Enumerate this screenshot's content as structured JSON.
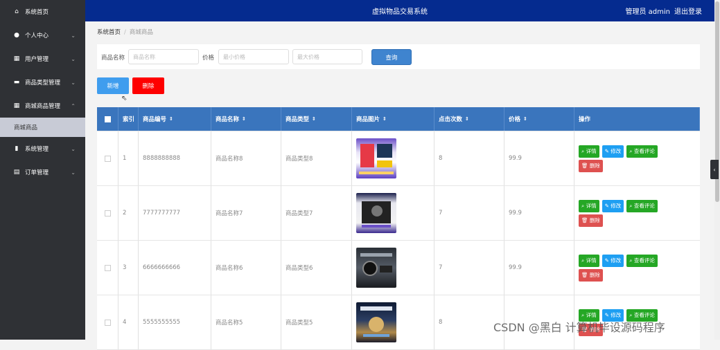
{
  "sidebar": {
    "items": [
      {
        "label": "系统首页",
        "icon": "home-icon",
        "chevron": ""
      },
      {
        "label": "个人中心",
        "icon": "user-icon",
        "chevron": "⌄"
      },
      {
        "label": "用户管理",
        "icon": "grid-icon",
        "chevron": "⌄"
      },
      {
        "label": "商品类型管理",
        "icon": "briefcase-icon",
        "chevron": "⌄"
      },
      {
        "label": "商城商品管理",
        "icon": "grid-icon",
        "chevron": "⌃"
      },
      {
        "label": "系统管理",
        "icon": "bar-chart-icon",
        "chevron": "⌄"
      },
      {
        "label": "订单管理",
        "icon": "clipboard-icon",
        "chevron": "⌄"
      }
    ],
    "sub_item": "商城商品"
  },
  "header": {
    "title": "虚拟物品交易系统",
    "user": "管理员 admin",
    "logout": "退出登录"
  },
  "breadcrumb": {
    "home": "系统首页",
    "sep": "/",
    "current": "商城商品"
  },
  "search": {
    "name_label": "商品名称",
    "name_placeholder": "商品名称",
    "price_label": "价格",
    "min_placeholder": "最小价格",
    "max_placeholder": "最大价格",
    "query_button": "查询"
  },
  "actions": {
    "add": "新增",
    "delete": "删除"
  },
  "table": {
    "headers": [
      "索引",
      "商品编号",
      "商品名称",
      "商品类型",
      "商品图片",
      "点击次数",
      "价格",
      "操作"
    ],
    "sort_glyph": "⇕",
    "op_labels": {
      "detail": "详情",
      "edit": "修改",
      "review": "查看评论",
      "delete": "删除"
    },
    "rows": [
      {
        "index": "1",
        "code": "8888888888",
        "name": "商品名称8",
        "type": "商品类型8",
        "clicks": "8",
        "price": "99.9"
      },
      {
        "index": "2",
        "code": "7777777777",
        "name": "商品名称7",
        "type": "商品类型7",
        "clicks": "7",
        "price": "99.9"
      },
      {
        "index": "3",
        "code": "6666666666",
        "name": "商品名称6",
        "type": "商品类型6",
        "clicks": "7",
        "price": "99.9"
      },
      {
        "index": "4",
        "code": "5555555555",
        "name": "商品名称5",
        "type": "商品类型5",
        "clicks": "8",
        "price": ""
      }
    ]
  },
  "watermark": "CSDN @黑白  计算机毕设源码程序",
  "colors": {
    "sidebar": "#2f3135",
    "header": "#052b8f",
    "table_header": "#3a75bd",
    "delete": "#fe0000"
  }
}
